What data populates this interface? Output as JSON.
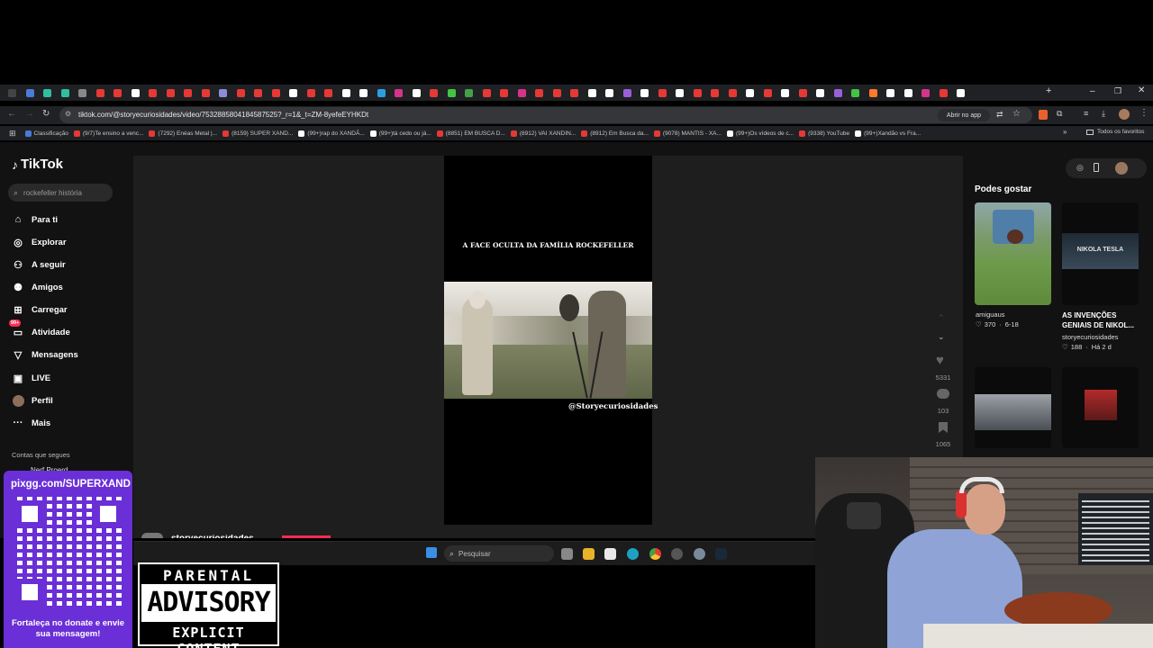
{
  "browser": {
    "url": "tiktok.com/@storyecuriosidades/video/7532885804184587525?_r=1&_t=ZM-8yefeEYHKDt",
    "open_in_app": "Abrir no app",
    "all_favorites": "Todos os favoritos",
    "bookmarks": [
      {
        "label": "Classificação",
        "color": "#4a7bd9"
      },
      {
        "label": "(9/7)Te ensino a venc...",
        "color": "#e53935"
      },
      {
        "label": "(7292) Enéas Metal |...",
        "color": "#e53935"
      },
      {
        "label": "(8159) SUPER XAND...",
        "color": "#e53935"
      },
      {
        "label": "(99+)rap do XANDÃ...",
        "color": "#ffffff"
      },
      {
        "label": "(99+)tá cedo ou já...",
        "color": "#ffffff"
      },
      {
        "label": "(8851) EM BUSCA D...",
        "color": "#e53935"
      },
      {
        "label": "(8912) VAI XANDIN...",
        "color": "#e53935"
      },
      {
        "label": "(8912) Em Busca da...",
        "color": "#e53935"
      },
      {
        "label": "(9078) MANTIS - XA...",
        "color": "#e53935"
      },
      {
        "label": "(99+)Os vídeos de c...",
        "color": "#ffffff"
      },
      {
        "label": "(9338) YouTube",
        "color": "#e53935"
      },
      {
        "label": "(99+)Xandão vs Fra...",
        "color": "#ffffff"
      }
    ]
  },
  "tiktok": {
    "logo": "TikTok",
    "search_placeholder": "rockefeller história",
    "nav": [
      {
        "label": "Para ti",
        "icon": "home-icon"
      },
      {
        "label": "Explorar",
        "icon": "compass-icon"
      },
      {
        "label": "A seguir",
        "icon": "following-icon"
      },
      {
        "label": "Amigos",
        "icon": "friends-icon"
      },
      {
        "label": "Carregar",
        "icon": "upload-icon"
      },
      {
        "label": "Atividade",
        "icon": "activity-icon",
        "badge": "99+"
      },
      {
        "label": "Mensagens",
        "icon": "messages-icon"
      },
      {
        "label": "LIVE",
        "icon": "live-icon"
      },
      {
        "label": "Perfil",
        "icon": "profile-icon"
      },
      {
        "label": "Mais",
        "icon": "more-icon"
      }
    ],
    "following_heading": "Contas que segues",
    "following_user": "Nerf Proerd",
    "video": {
      "caption_title": "A FACE OCULTA DA FAMÍLIA ROCKEFELLER",
      "watermark": "@Storyecuriosidades",
      "author": "storyecuriosidades",
      "likes": "5331",
      "comments": "103",
      "saves": "1065"
    },
    "sidebar_title": "Podes gostar",
    "suggestions": [
      {
        "title": "",
        "author": "amiguaus",
        "likes": "370",
        "date": "6-18"
      },
      {
        "title": "AS INVENÇÕES GENIAIS DE NIKOL...",
        "author": "storyecuriosidades",
        "likes": "188",
        "date": "Há 2 d",
        "thumb_text": "NIKOLA TESLA"
      }
    ]
  },
  "stream_overlay": {
    "donate_url": "pixgg.com/SUPERXAND",
    "donate_message": "Fortaleça no donate e envie sua mensagem!",
    "advisory_top": "PARENTAL",
    "advisory_middle": "ADVISORY",
    "advisory_bottom": "EXPLICIT CONTENT"
  },
  "taskbar": {
    "search_label": "Pesquisar"
  }
}
